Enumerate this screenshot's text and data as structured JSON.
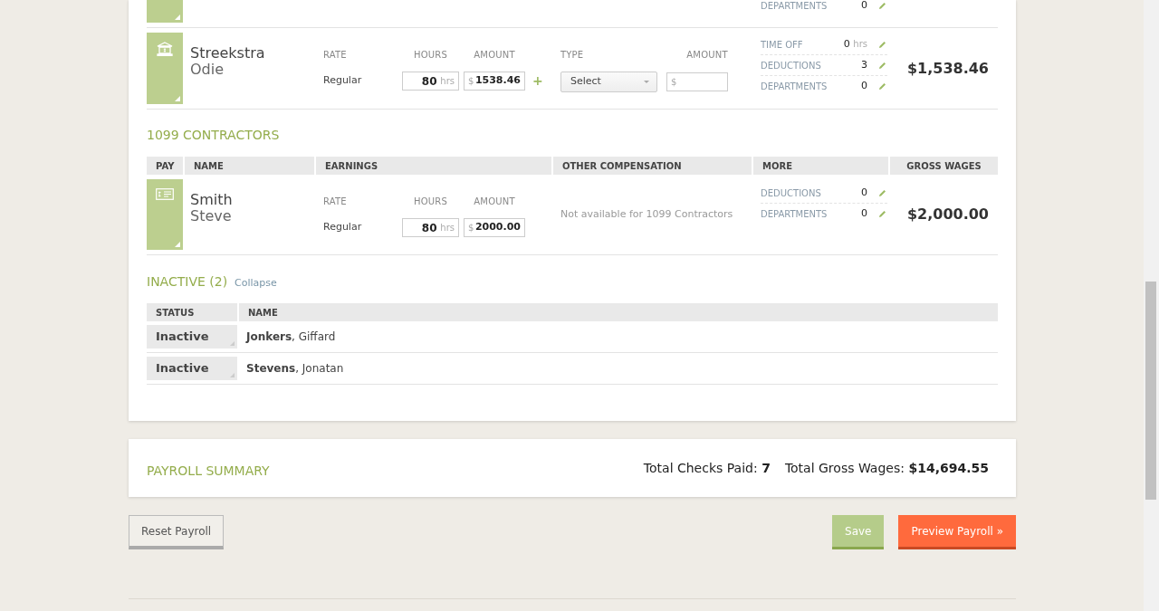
{
  "partial_row": {
    "more": [
      {
        "label": "DEPARTMENTS",
        "value": "0"
      }
    ]
  },
  "employees": [
    {
      "last": "Streekstra",
      "first": "Odie",
      "kind": "bank",
      "earnings": {
        "rate_label": "RATE",
        "hours_label": "HOURS",
        "amount_label": "AMOUNT",
        "rate": "Regular",
        "hours": "80",
        "hours_unit": "hrs",
        "currency": "$",
        "amount": "1538.46",
        "add": "+"
      },
      "other": {
        "type_label": "TYPE",
        "amount_label": "AMOUNT",
        "select": "Select",
        "amount_placeholder": "$"
      },
      "more": [
        {
          "label": "TIME OFF",
          "value": "0",
          "unit": "hrs"
        },
        {
          "label": "DEDUCTIONS",
          "value": "3"
        },
        {
          "label": "DEPARTMENTS",
          "value": "0"
        }
      ],
      "gross": "$1,538.46"
    }
  ],
  "contractors": {
    "title": "1099 CONTRACTORS",
    "columns": [
      "PAY",
      "NAME",
      "EARNINGS",
      "OTHER COMPENSATION",
      "MORE",
      "GROSS WAGES"
    ],
    "rows": [
      {
        "last": "Smith",
        "first": "Steve",
        "kind": "check",
        "earnings": {
          "rate_label": "RATE",
          "hours_label": "HOURS",
          "amount_label": "AMOUNT",
          "rate": "Regular",
          "hours": "80",
          "hours_unit": "hrs",
          "currency": "$",
          "amount": "2000.00"
        },
        "other_note": "Not available for 1099 Contractors",
        "more": [
          {
            "label": "DEDUCTIONS",
            "value": "0"
          },
          {
            "label": "DEPARTMENTS",
            "value": "0"
          }
        ],
        "gross": "$2,000.00"
      }
    ]
  },
  "inactive": {
    "title": "INACTIVE (2)",
    "toggle": "Collapse",
    "columns": [
      "STATUS",
      "NAME"
    ],
    "rows": [
      {
        "status": "Inactive",
        "name": "**Jonkers**, Giffard"
      },
      {
        "status": "Inactive",
        "name": "**Stevens**, Jonatan"
      }
    ]
  },
  "summary": {
    "title": "PAYROLL SUMMARY",
    "checks_label": "Total Checks Paid:",
    "checks": "7",
    "wages_label": "Total Gross Wages:",
    "wages": "$14,694.55"
  },
  "buttons": {
    "reset": "Reset Payroll",
    "save": "Save",
    "preview": "Preview Payroll »"
  }
}
